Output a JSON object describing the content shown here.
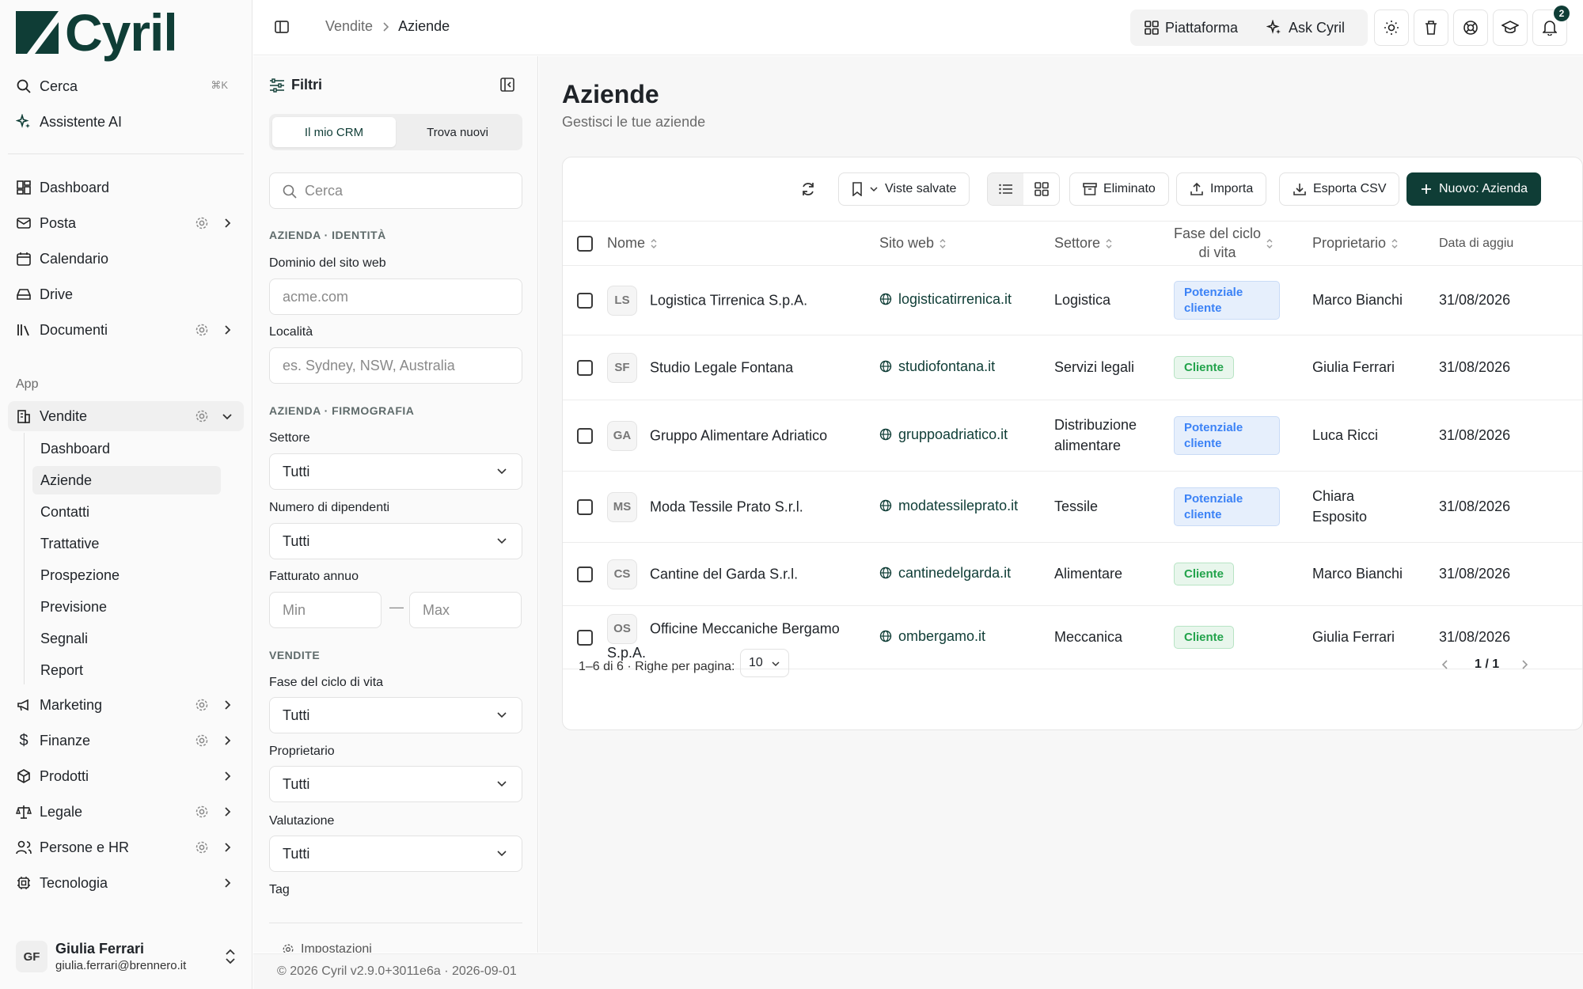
{
  "app": {
    "brand": "Cyril"
  },
  "sidebar": {
    "search_label": "Cerca",
    "search_shortcut": "⌘K",
    "assistant_label": "Assistente AI",
    "nav": {
      "dashboard": "Dashboard",
      "mail": "Posta",
      "calendar": "Calendario",
      "drive": "Drive",
      "documents": "Documenti"
    },
    "section_label": "App",
    "apps": {
      "sales": "Vendite",
      "marketing": "Marketing",
      "finance": "Finanze",
      "products": "Prodotti",
      "legal": "Legale",
      "people": "Persone e HR",
      "tech": "Tecnologia"
    },
    "sales_sub": [
      "Dashboard",
      "Aziende",
      "Contatti",
      "Trattative",
      "Prospezione",
      "Previsione",
      "Segnali",
      "Report"
    ],
    "user": {
      "initials": "GF",
      "name": "Giulia Ferrari",
      "email": "giulia.ferrari@brennero.it"
    }
  },
  "topbar": {
    "breadcrumb": [
      "Vendite",
      "Aziende"
    ],
    "platform_label": "Piattaforma",
    "ask_label": "Ask Cyril",
    "notifications_count": "2"
  },
  "filters": {
    "title": "Filtri",
    "tabs": [
      "Il mio CRM",
      "Trova nuovi"
    ],
    "search_placeholder": "Cerca",
    "section_identity": "AZIENDA · IDENTITÀ",
    "domain_label": "Dominio del sito web",
    "domain_placeholder": "acme.com",
    "location_label": "Località",
    "location_placeholder": "es. Sydney, NSW, Australia",
    "section_firmographic": "AZIENDA · FIRMOGRAFIA",
    "sector_label": "Settore",
    "sector_value": "Tutti",
    "employees_label": "Numero di dipendenti",
    "employees_value": "Tutti",
    "revenue_label": "Fatturato annuo",
    "revenue_min": "Min",
    "revenue_dash": "—",
    "revenue_max": "Max",
    "section_sales": "VENDITE",
    "lifecycle_label": "Fase del ciclo di vita",
    "lifecycle_value": "Tutti",
    "owner_label": "Proprietario",
    "owner_value": "Tutti",
    "rating_label": "Valutazione",
    "rating_value": "Tutti",
    "tag_label": "Tag",
    "settings_label": "Impostazioni"
  },
  "main": {
    "title": "Aziende",
    "subtitle": "Gestisci le tue aziende",
    "toolbar": {
      "saved_views": "Viste salvate",
      "deleted": "Eliminato",
      "import": "Importa",
      "export": "Esporta CSV",
      "new": "Nuovo: Azienda"
    },
    "columns": {
      "name": "Nome",
      "website": "Sito web",
      "sector": "Settore",
      "lifecycle_1": "Fase del ciclo",
      "lifecycle_2": "di vita",
      "owner": "Proprietario",
      "updated": "Data di aggiu"
    },
    "rows": [
      {
        "initials": "LS",
        "name": "Logistica Tirrenica S.p.A.",
        "site": "logisticatirrenica.it",
        "sector_1": "Logistica",
        "sector_2": "",
        "stage_1": "Potenziale",
        "stage_2": "cliente",
        "stage_type": "lead",
        "owner_1": "Marco Bianchi",
        "owner_2": "",
        "date": "31/08/2026"
      },
      {
        "initials": "SF",
        "name": "Studio Legale Fontana",
        "site": "studiofontana.it",
        "sector_1": "Servizi legali",
        "sector_2": "",
        "stage_1": "Cliente",
        "stage_2": "",
        "stage_type": "cust",
        "owner_1": "Giulia Ferrari",
        "owner_2": "",
        "date": "31/08/2026"
      },
      {
        "initials": "GA",
        "name": "Gruppo Alimentare Adriatico",
        "site": "gruppoadriatico.it",
        "sector_1": "Distribuzione",
        "sector_2": "alimentare",
        "stage_1": "Potenziale",
        "stage_2": "cliente",
        "stage_type": "lead",
        "owner_1": "Luca Ricci",
        "owner_2": "",
        "date": "31/08/2026"
      },
      {
        "initials": "MS",
        "name": "Moda Tessile Prato S.r.l.",
        "site": "modatessileprato.it",
        "sector_1": "Tessile",
        "sector_2": "",
        "stage_1": "Potenziale",
        "stage_2": "cliente",
        "stage_type": "lead",
        "owner_1": "Chiara",
        "owner_2": "Esposito",
        "date": "31/08/2026"
      },
      {
        "initials": "CS",
        "name": "Cantine del Garda S.r.l.",
        "site": "cantinedelgarda.it",
        "sector_1": "Alimentare",
        "sector_2": "",
        "stage_1": "Cliente",
        "stage_2": "",
        "stage_type": "cust",
        "owner_1": "Marco Bianchi",
        "owner_2": "",
        "date": "31/08/2026"
      },
      {
        "initials": "OS",
        "name": "Officine Meccaniche Bergamo S.p.A.",
        "site": "ombergamo.it",
        "sector_1": "Meccanica",
        "sector_2": "",
        "stage_1": "Cliente",
        "stage_2": "",
        "stage_type": "cust",
        "owner_1": "Giulia Ferrari",
        "owner_2": "",
        "date": "31/08/2026"
      }
    ],
    "pager": {
      "info": "1–6 di 6 · Righe per pagina:",
      "rows_per_page": "10",
      "page": "1 / 1"
    }
  },
  "footer": {
    "text": "© 2026 Cyril v2.9.0+3011e6a · 2026-09-01"
  },
  "colors": {
    "brand": "#0f3d36",
    "lead": "#3b82f6",
    "customer": "#22a34b"
  }
}
